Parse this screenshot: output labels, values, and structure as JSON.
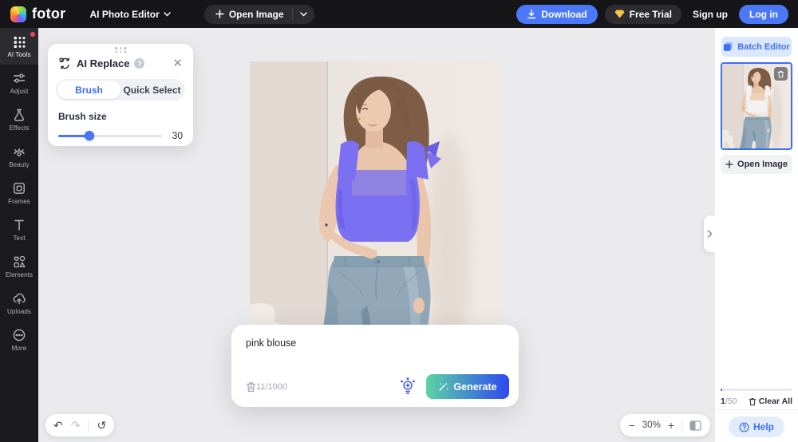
{
  "topbar": {
    "logo_text": "fotor",
    "editor_menu_label": "AI Photo Editor",
    "open_image_label": "Open Image",
    "download_label": "Download",
    "free_trial_label": "Free Trial",
    "signup_label": "Sign up",
    "login_label": "Log in"
  },
  "left_nav": {
    "items": [
      {
        "label": "AI Tools",
        "icon": "ai-tools-icon",
        "active": true,
        "notification": true
      },
      {
        "label": "Adjust",
        "icon": "adjust-icon",
        "active": false
      },
      {
        "label": "Effects",
        "icon": "effects-icon",
        "active": false
      },
      {
        "label": "Beauty",
        "icon": "beauty-icon",
        "active": false
      },
      {
        "label": "Frames",
        "icon": "frames-icon",
        "active": false
      },
      {
        "label": "Text",
        "icon": "text-icon",
        "active": false
      },
      {
        "label": "Elements",
        "icon": "elements-icon",
        "active": false
      },
      {
        "label": "Uploads",
        "icon": "uploads-icon",
        "active": false
      },
      {
        "label": "More",
        "icon": "more-icon",
        "active": false
      }
    ]
  },
  "tool_panel": {
    "title": "AI Replace",
    "tabs": [
      {
        "label": "Brush",
        "active": true
      },
      {
        "label": "Quick Select",
        "active": false
      }
    ],
    "brush_size_label": "Brush size",
    "brush_size_value": 30,
    "brush_size_max": 100
  },
  "prompt_box": {
    "prompt_text": "pink blouse",
    "char_count": "11/1000",
    "generate_label": "Generate"
  },
  "canvas_toolbar": {
    "zoom_level": "30%",
    "zoom_out": "−",
    "zoom_in": "+"
  },
  "right_panel": {
    "batch_editor_label": "Batch Editor",
    "open_image_label": "Open Image",
    "usage_current": "1",
    "usage_total": "/50",
    "usage_used": 1,
    "usage_limit": 50,
    "clear_all_label": "Clear All",
    "help_label": "Help"
  },
  "colors": {
    "accent_blue": "#4b78f9",
    "panel_blue": "#3d6ef7",
    "mask_purple": "#7b70f1",
    "generate_gradient_start": "#5bd3a5",
    "generate_gradient_end": "#2f49ee",
    "notification_red": "#f0475c",
    "trial_diamond_yellow": "#f6c445"
  }
}
